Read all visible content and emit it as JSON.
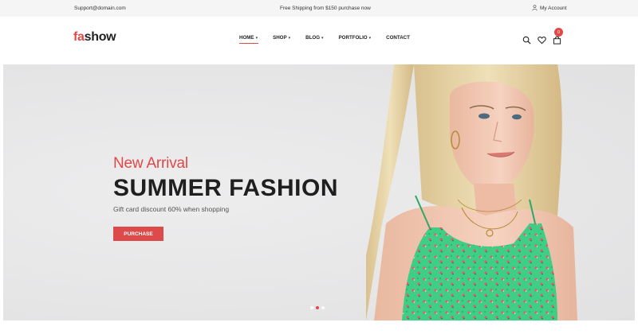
{
  "topbar": {
    "email": "Support@domain.com",
    "shipping": "Free Shipping from $150 purchase now",
    "account": "My Account"
  },
  "logo": {
    "part1": "fa",
    "part2": "show"
  },
  "nav": [
    {
      "label": "HOME",
      "has_caret": true,
      "active": true
    },
    {
      "label": "SHOP",
      "has_caret": true,
      "active": false
    },
    {
      "label": "BLOG",
      "has_caret": true,
      "active": false
    },
    {
      "label": "PORTFOLIO",
      "has_caret": true,
      "active": false
    },
    {
      "label": "CONTACT",
      "has_caret": false,
      "active": false
    }
  ],
  "cart": {
    "count": "0"
  },
  "hero": {
    "kicker": "New Arrival",
    "title": "SUMMER FASHION",
    "subtitle": "Gift card discount 60% when shopping",
    "button": "PURCHASE",
    "slide_count": 3,
    "active_slide": 2
  },
  "colors": {
    "accent": "#e04848",
    "dress": "#3ecf84",
    "hair": "#e6d3a7",
    "skin": "#f3c9b4"
  },
  "icons": [
    "user-icon",
    "search-icon",
    "heart-icon",
    "cart-icon",
    "caret-down-icon"
  ]
}
